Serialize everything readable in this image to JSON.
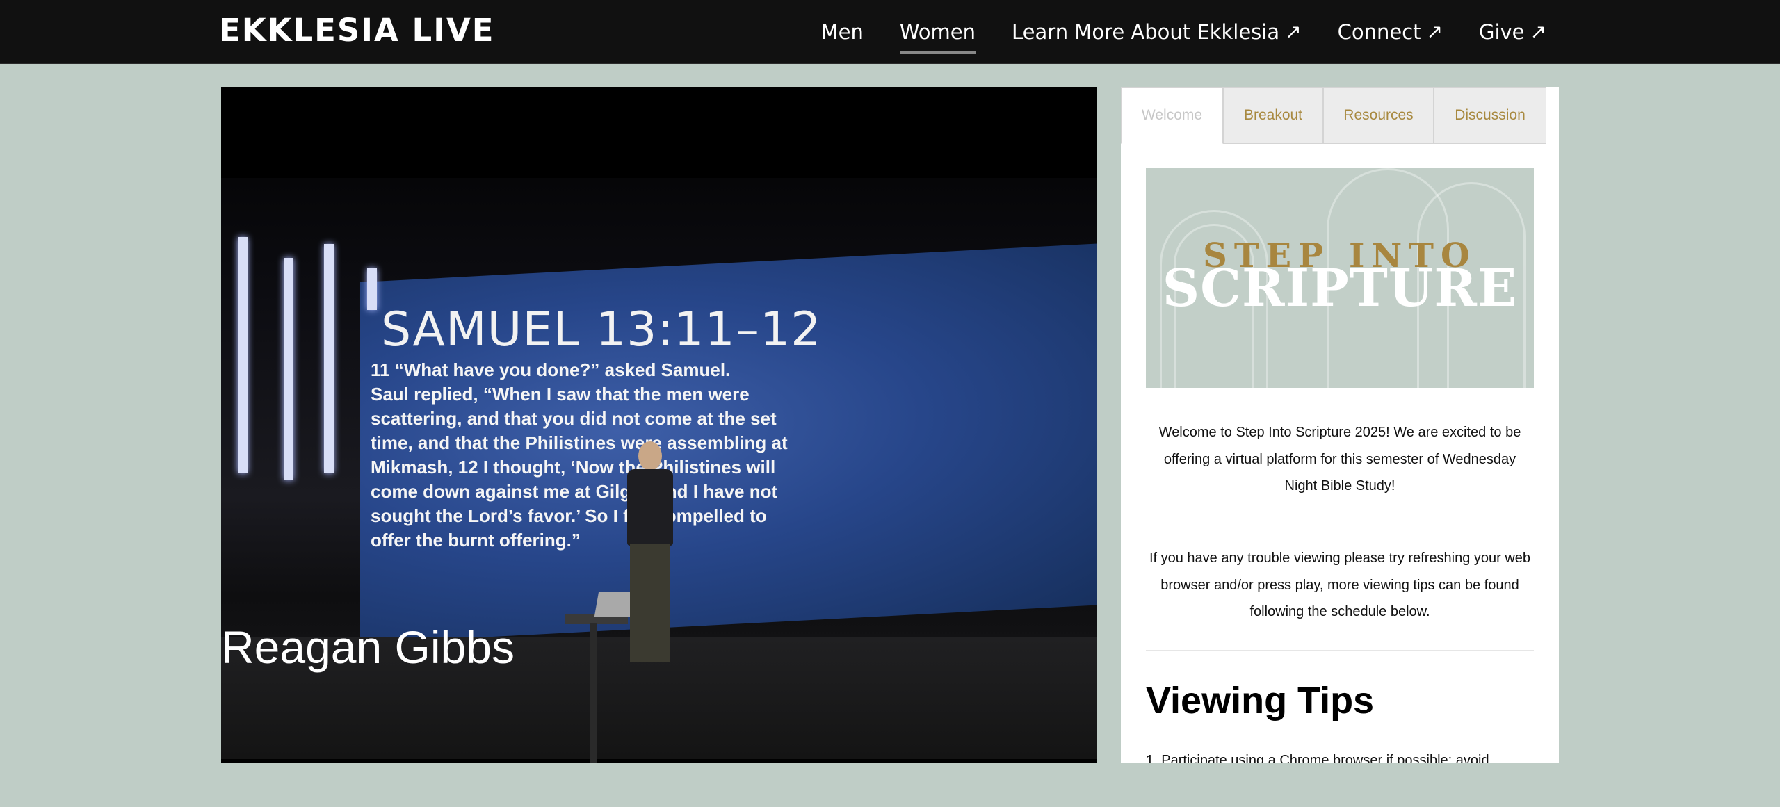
{
  "header": {
    "brand": "EKKLESIA LIVE",
    "nav": [
      {
        "label": "Men",
        "external": false,
        "active": false
      },
      {
        "label": "Women",
        "external": false,
        "active": true
      },
      {
        "label": "Learn More About Ekklesia",
        "external": true,
        "active": false
      },
      {
        "label": "Connect",
        "external": true,
        "active": false
      },
      {
        "label": "Give",
        "external": true,
        "active": false
      }
    ],
    "external_icon": "↗"
  },
  "video": {
    "screen_title": "SAMUEL 13:11–12",
    "screen_text": "11 “What have you done?” asked Samuel.\nSaul replied, “When I saw that the men were\nscattering, and that you did not come at the set\ntime, and that the Philistines were assembling at\nMikmash, 12 I thought, ‘Now the Philistines will\ncome down against me at Gilgal, and I have not\nsought the Lord’s favor.’ So I felt compelled to\noffer the burnt offering.”",
    "lower_third": "Reagan Gibbs"
  },
  "sidebar": {
    "tabs": [
      {
        "label": "Welcome",
        "active": true
      },
      {
        "label": "Breakout",
        "active": false
      },
      {
        "label": "Resources",
        "active": false
      },
      {
        "label": "Discussion",
        "active": false
      }
    ],
    "banner": {
      "line1": "STEP INTO",
      "line2": "SCRIPTURE"
    },
    "welcome_text": "Welcome to Step Into Scripture 2025! We are excited to be offering a virtual platform for this semester of Wednesday Night Bible Study!",
    "trouble_text": "If you have any trouble viewing please try refreshing your web browser and/or press play, more viewing tips can be found following the schedule below.",
    "tips_heading": "Viewing Tips",
    "tips": [
      "1. Participate using a Chrome browser if possible; avoid"
    ]
  },
  "colors": {
    "header_bg": "#111111",
    "page_bg": "#bfcdc6",
    "tab_text": "#a8893f",
    "banner_gold": "#a8863f"
  }
}
